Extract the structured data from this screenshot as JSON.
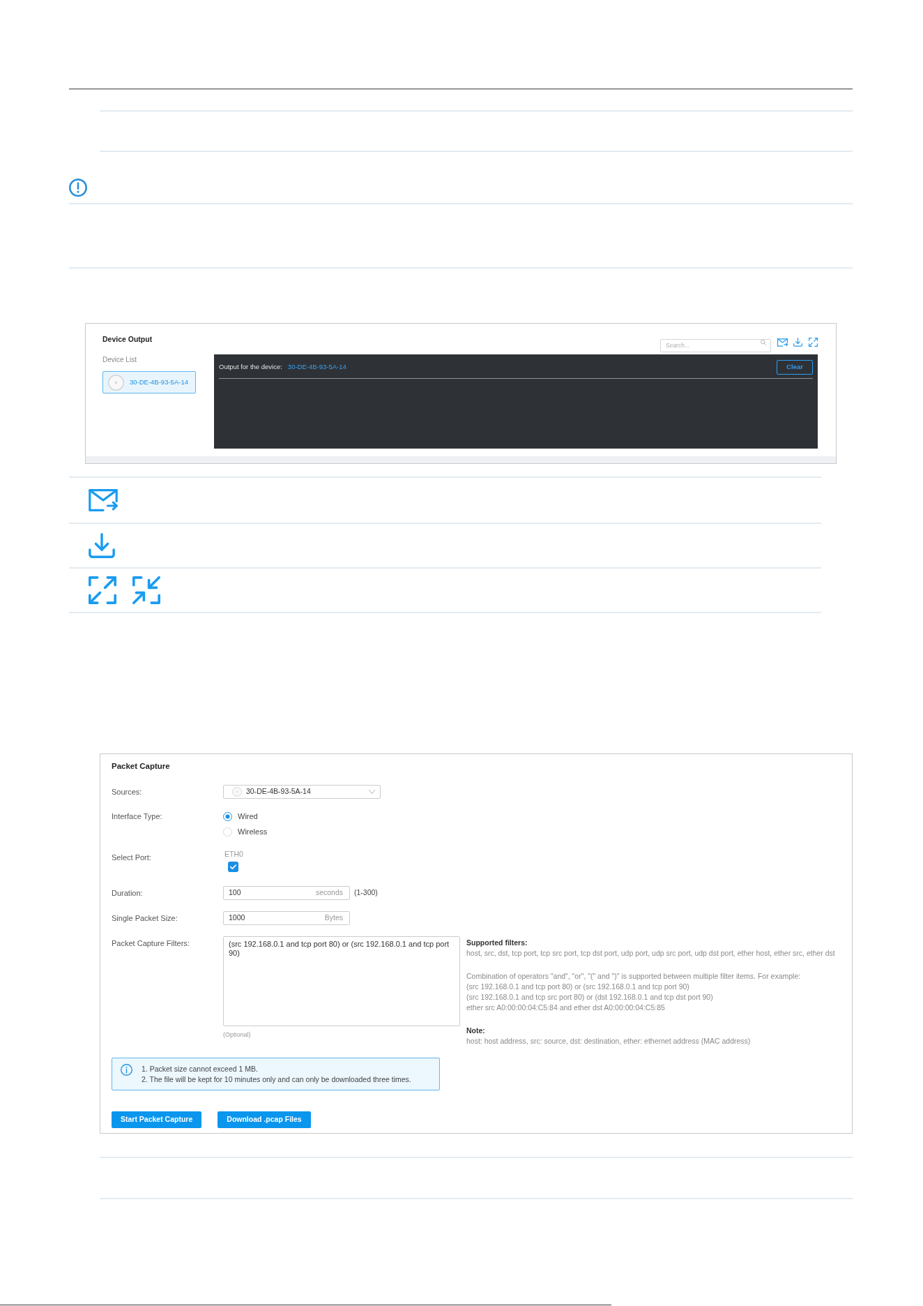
{
  "device_output": {
    "title": "Device Output",
    "search": {
      "placeholder": "Search..."
    },
    "device_list": {
      "label": "Device List",
      "items": [
        {
          "name": "30-DE-4B-93-5A-14",
          "selected": true
        }
      ]
    },
    "console": {
      "label": "Output for the device:",
      "device": "30-DE-4B-93-5A-14",
      "clear_button": "Clear"
    }
  },
  "icon_table": {
    "rows": [
      {
        "kind": "mail"
      },
      {
        "kind": "download"
      },
      {
        "kind": "resize"
      }
    ]
  },
  "packet_capture": {
    "title": "Packet Capture",
    "fields": [
      {
        "kind": "select",
        "label": "Sources:",
        "value": "30-DE-4B-93-5A-14"
      },
      {
        "kind": "radio",
        "label": "Interface Type:",
        "options": [
          {
            "label": "Wired",
            "selected": true
          },
          {
            "label": "Wireless",
            "selected": false
          }
        ]
      },
      {
        "kind": "checkbox",
        "label": "Select Port:",
        "options": [
          {
            "label": "ETH0",
            "checked": true
          }
        ]
      },
      {
        "kind": "input",
        "label": "Duration:",
        "value": "100",
        "suffix": "seconds",
        "hint": "(1-300)"
      },
      {
        "kind": "input",
        "label": "Single Packet Size:",
        "value": "1000",
        "suffix": "Bytes"
      },
      {
        "kind": "textarea",
        "label": "Packet Capture Filters:",
        "value": "(src 192.168.0.1 and tcp port 80) or (src 192.168.0.1 and tcp port 90)",
        "note": "(Optional)"
      }
    ],
    "help": [
      {
        "heading": "Supported filters:",
        "paragraphs": [
          [
            "host, src, dst, tcp port, tcp src port, tcp dst port, udp port, udp src port, udp dst port, ether host, ether src, ether dst"
          ],
          [
            "Combination of operators \"and\", \"or\", \"(\" and \")\" is supported between multiple filter items. For example:",
            "(src 192.168.0.1 and tcp port 80) or (src 192.168.0.1 and tcp port 90)",
            "(src 192.168.0.1 and tcp src port 80) or (dst 192.168.0.1 and tcp dst port 90)",
            "ether src A0:00:00:04:C5:84 and ether dst A0:00:00:04:C5:85"
          ]
        ]
      },
      {
        "heading": "Note:",
        "paragraphs": [
          [
            "host: host address, src: source, dst: destination, ether: ethernet address (MAC address)"
          ]
        ]
      }
    ],
    "notice": [
      "1. Packet size cannot exceed 1 MB.",
      "2. The file will be kept for 10 minutes only and can only be downloaded three times."
    ],
    "buttons": [
      "Start Packet Capture",
      "Download .pcap Files"
    ]
  }
}
